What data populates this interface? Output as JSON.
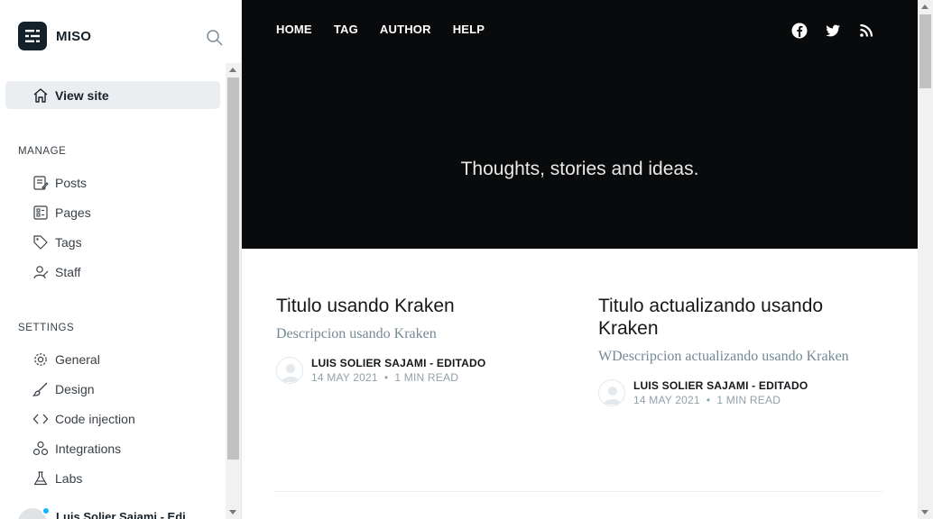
{
  "sidebar": {
    "brand": "MISO",
    "view_site": "View site",
    "manage_label": "MANAGE",
    "manage_items": [
      "Posts",
      "Pages",
      "Tags",
      "Staff"
    ],
    "settings_label": "SETTINGS",
    "settings_items": [
      "General",
      "Design",
      "Code injection",
      "Integrations",
      "Labs"
    ],
    "user_name": "Luis Solier Sajami - Edi"
  },
  "site": {
    "nav": [
      "HOME",
      "TAG",
      "AUTHOR",
      "HELP"
    ],
    "social_icons": [
      "facebook-icon",
      "twitter-icon",
      "rss-icon"
    ],
    "description": "Thoughts, stories and ideas."
  },
  "posts": [
    {
      "title": "Titulo usando Kraken",
      "excerpt": "Descripcion usando Kraken",
      "author": "LUIS SOLIER SAJAMI - EDITADO",
      "date": "14 MAY 2021",
      "read_time": "1 MIN READ"
    },
    {
      "title": "Titulo actualizando usando Kraken",
      "excerpt": "WDescripcion actualizando usando Kraken",
      "author": "LUIS SOLIER SAJAMI - EDITADO",
      "date": "14 MAY 2021",
      "read_time": "1 MIN READ"
    }
  ],
  "colors": {
    "hero_bg": "#090a0b",
    "active_nav_bg": "#ebeef0",
    "excerpt": "#738a94",
    "meta": "#90a2aa"
  }
}
